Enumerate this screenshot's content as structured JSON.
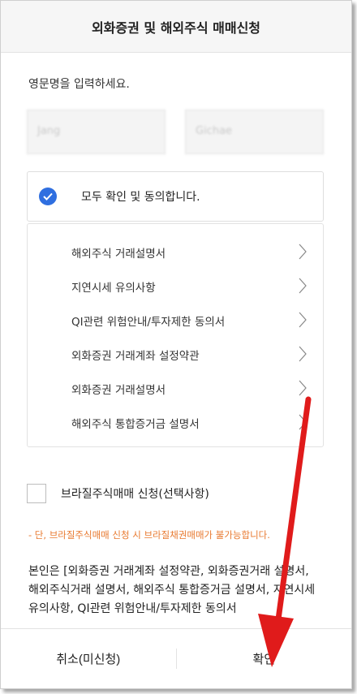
{
  "header": {
    "title": "외화증권 및 해외주식 매매신청"
  },
  "form": {
    "prompt": "영문명을 입력하세요.",
    "first_name_value": "Jang",
    "last_name_value": "Gichae"
  },
  "agree_all": {
    "label": "모두 확인 및 동의합니다.",
    "checked": true,
    "check_color": "#2f6fe0"
  },
  "terms": [
    {
      "label": "해외주식 거래설명서"
    },
    {
      "label": "지연시세 유의사항"
    },
    {
      "label": "QI관련 위험안내/투자제한 동의서"
    },
    {
      "label": "외화증권 거래계좌 설정약관"
    },
    {
      "label": "외화증권 거래설명서"
    },
    {
      "label": "해외주식 통합증거금 설명서"
    }
  ],
  "brazil": {
    "label": "브라질주식매매 신청(선택사항)",
    "checked": false
  },
  "warning": {
    "text": "- 단, 브라질주식매매 신청 시 브라질채권매매가 불가능합니다.",
    "color": "#e8792f"
  },
  "consent": {
    "text": "본인은 [외화증권 거래계좌 설정약관, 외화증권거래 설명서, 해외주식거래 설명서, 해외주식 통합증거금 설명서, 지연시세 유의사항, QI관련 위험안내/투자제한 동의서"
  },
  "buttons": {
    "cancel_label": "취소(미신청)",
    "confirm_label": "확인"
  },
  "annotation": {
    "arrow_color": "#e01b1b",
    "icon": "red-arrow-icon"
  }
}
